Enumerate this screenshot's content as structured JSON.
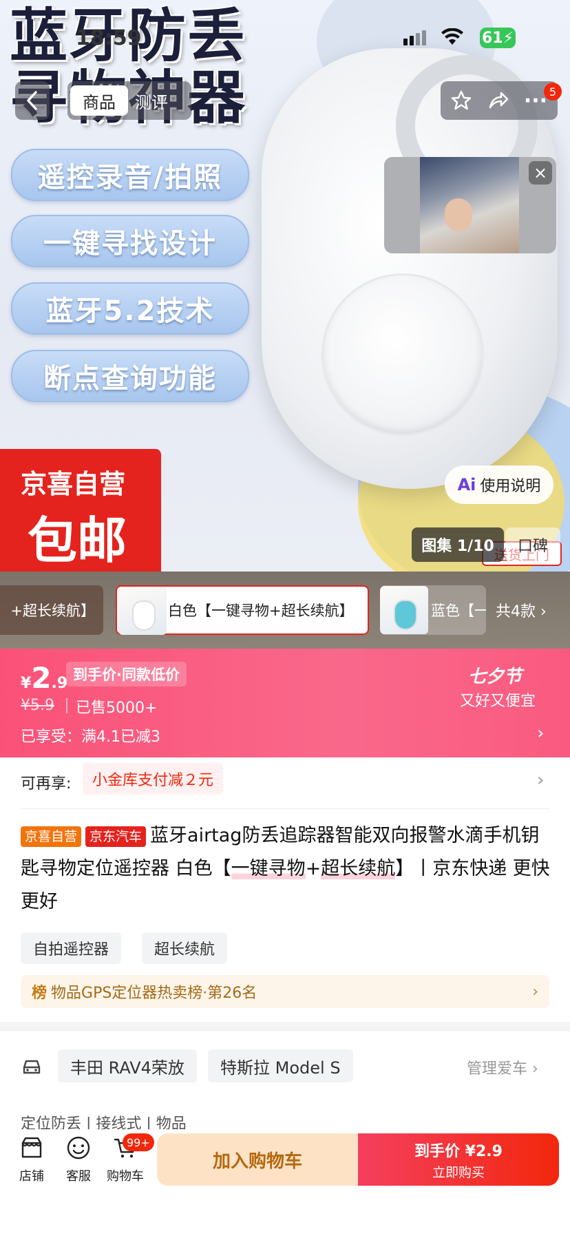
{
  "status_bar": {
    "time": "18:59",
    "battery": "61"
  },
  "hero": {
    "title_line1": "蓝牙防丢",
    "title_line2": "寻物神器",
    "features": [
      "遥控录音/拍照",
      "一键寻找设计",
      "蓝牙5.2技术",
      "断点查询功能"
    ],
    "promo_line1": "京喜自营",
    "promo_line2": "包邮"
  },
  "nav": {
    "tab_active": "商品",
    "tab_review": "测评",
    "cart_badge": "5"
  },
  "video": {
    "close_label": "×"
  },
  "image_overlays": {
    "manual_icon": "Ai",
    "manual_label": "使用说明",
    "gallery_label": "图集 1/10",
    "koubei_label": "口碑",
    "delivery_label": "送货上门"
  },
  "variants": {
    "items": [
      {
        "label": "+超长续航】"
      },
      {
        "label": "白色【一键寻物+超长续航】"
      },
      {
        "label": "蓝色【一"
      }
    ],
    "count_label": "共4款 ›"
  },
  "price": {
    "currency": "¥",
    "integer": "2",
    "decimal": ".9",
    "tag": "到手价·同款低价",
    "original": "¥5.9",
    "sold": "已售5000+",
    "enjoyed": "已享受：满4.1已减3",
    "festival_title": "七夕节",
    "festival_sub": "又好又便宜"
  },
  "more_discount": {
    "label": "可再享:",
    "chip": "小金库支付减２元"
  },
  "product": {
    "badge1": "京喜自营",
    "badge2": "京东汽车",
    "title_part1": "蓝牙airtag防丢追踪器智能双向报警水滴手机钥匙寻物定位遥控器 白色【",
    "title_hl1": "一键寻物",
    "title_plus": "+",
    "title_hl2": "超长续航",
    "title_part2": "】丨京东快递 更快更好",
    "chips": [
      "自拍遥控器",
      "超长续航"
    ],
    "rank_icon": "榜",
    "rank_text": "物品GPS定位器热卖榜·第26名"
  },
  "cars": {
    "items": [
      "丰田 RAV4荣放",
      "特斯拉 Model S"
    ],
    "manage": "管理爱车 ›",
    "peek_text": "定位防丢   |   接线式   |   物品"
  },
  "bottom": {
    "shop": "店铺",
    "service": "客服",
    "cart": "购物车",
    "cart_badge": "99+",
    "add_cart": "加入购物车",
    "buy_price": "到手价 ¥2.9",
    "buy_now": "立即购买"
  },
  "colors": {
    "brand_red": "#f2270c",
    "price_band": "#fb5178",
    "add_cart_bg": "#fde2c6"
  }
}
